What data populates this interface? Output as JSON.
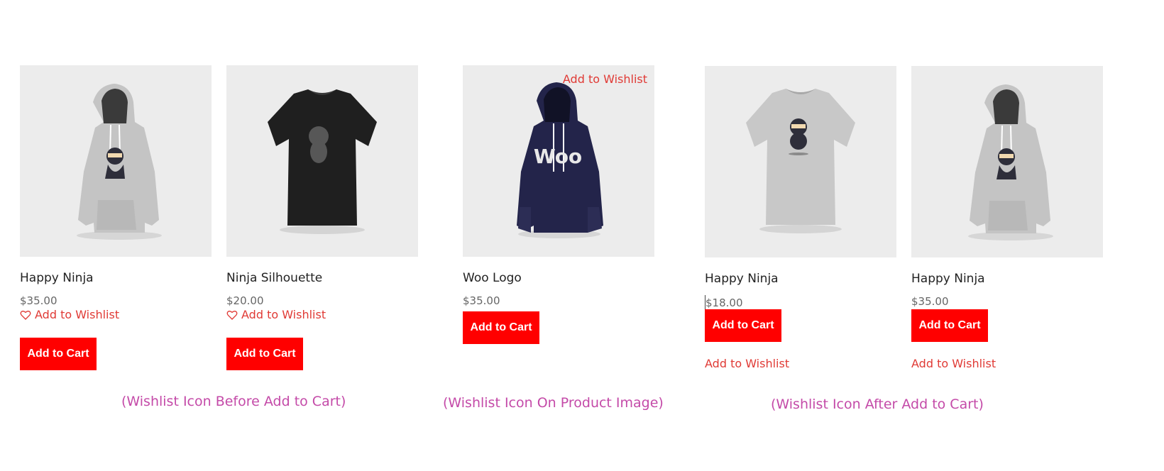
{
  "products": [
    {
      "title": "Happy Ninja",
      "price": "$35.00",
      "wishlist_label": "Add to Wishlist",
      "cart_label": "Add to Cart",
      "image_icon": "gray-hoodie-ninja-image"
    },
    {
      "title": "Ninja Silhouette",
      "price": "$20.00",
      "wishlist_label": "Add to Wishlist",
      "cart_label": "Add to Cart",
      "image_icon": "black-tshirt-image"
    },
    {
      "title": "Woo Logo",
      "price": "$35.00",
      "wishlist_label": "Add to Wishlist",
      "cart_label": "Add to Cart",
      "image_icon": "navy-hoodie-woo-image",
      "image_text": "Woo"
    },
    {
      "title": "Happy Ninja",
      "price": "$18.00",
      "wishlist_label": "Add to Wishlist",
      "cart_label": "Add to Cart",
      "image_icon": "gray-tshirt-ninja-image"
    },
    {
      "title": "Happy Ninja",
      "price": "$35.00",
      "wishlist_label": "Add to Wishlist",
      "cart_label": "Add to Cart",
      "image_icon": "gray-hoodie-ninja-image"
    }
  ],
  "captions": {
    "before": "(Wishlist Icon Before Add to Cart)",
    "on_image": "(Wishlist Icon On Product Image)",
    "after": "(Wishlist Icon After Add to Cart)"
  },
  "colors": {
    "accent_red": "#ff0000",
    "wishlist_red": "#e03a35",
    "caption_magenta": "#c44aa8",
    "image_background": "#ececec"
  }
}
